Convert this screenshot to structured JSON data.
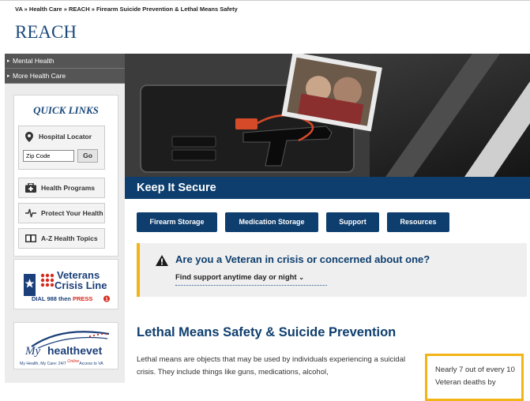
{
  "breadcrumb": "VA » Health Care » REACH » Firearm Suicide Prevention & Lethal Means Safety",
  "brand": "REACH",
  "sidebar": {
    "nav": [
      "Mental Health",
      "More Health Care"
    ],
    "quick_links_title": "QUICK LINKS",
    "hospital_locator": {
      "label": "Hospital Locator",
      "value": "Zip Code",
      "go": "Go"
    },
    "buttons": [
      {
        "label": "Health Programs",
        "icon": "first-aid-kit-icon"
      },
      {
        "label": "Protect Your Health",
        "icon": "heartbeat-icon"
      },
      {
        "label": "A-Z Health Topics",
        "icon": "book-icon"
      }
    ],
    "veterans_crisis_line": {
      "title1": "Veterans",
      "title2": "Crisis Line",
      "sub_a": "DIAL 988 then ",
      "sub_b": "PRESS",
      "press_num": "1"
    },
    "myhealthevet": {
      "my": "My",
      "name": "healthevet",
      "tagline_a": "My Health, My Care: 24/7",
      "tagline_online": "Online",
      "tagline_b": "Access to VA"
    }
  },
  "hero": {
    "banner": "Keep It Secure"
  },
  "tabs": [
    "Firearm Storage",
    "Medication Storage",
    "Support",
    "Resources"
  ],
  "crisis": {
    "question": "Are you a Veteran in crisis or concerned about one?",
    "sub": "Find support anytime day or night"
  },
  "lethal_means": {
    "heading": "Lethal Means Safety & Suicide Prevention",
    "body": "Lethal means are objects that may be used by individuals experiencing a suicidal crisis. They include things like guns, medications, alcohol,"
  },
  "stat": {
    "text": "Nearly 7 out of every 10 Veteran deaths by"
  },
  "colors": {
    "navy": "#0e3e6e",
    "gold": "#f2b416",
    "nav_gray": "#555555"
  }
}
